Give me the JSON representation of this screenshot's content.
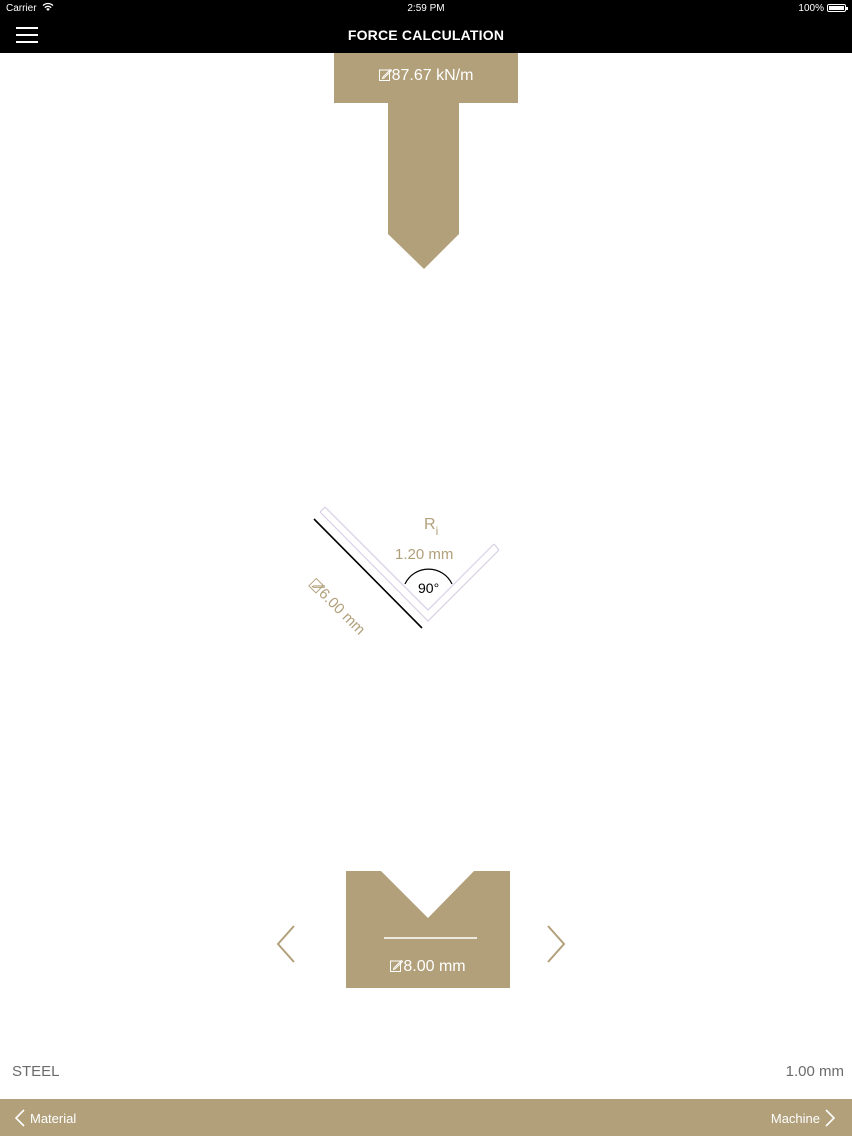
{
  "status_bar": {
    "carrier": "Carrier",
    "time": "2:59 PM",
    "battery_percent": "100%"
  },
  "nav": {
    "title": "FORCE CALCULATION",
    "menu_icon": "hamburger-menu-icon"
  },
  "punch": {
    "force": "87.67 kN/m",
    "edit_icon": "edit-icon"
  },
  "bend": {
    "radius_label": "R",
    "radius_subscript": "i",
    "radius_value": "1.20 mm",
    "angle": "90°",
    "flange_length": "6.00 mm"
  },
  "die": {
    "width": "8.00 mm",
    "prev_icon": "chevron-left-icon",
    "next_icon": "chevron-right-icon"
  },
  "material": {
    "name": "STEEL",
    "thickness": "1.00 mm"
  },
  "bottom_nav": {
    "back_label": "Material",
    "forward_label": "Machine"
  },
  "colors": {
    "accent": "#b1a07a",
    "bar": "#000000",
    "background": "#ffffff"
  }
}
